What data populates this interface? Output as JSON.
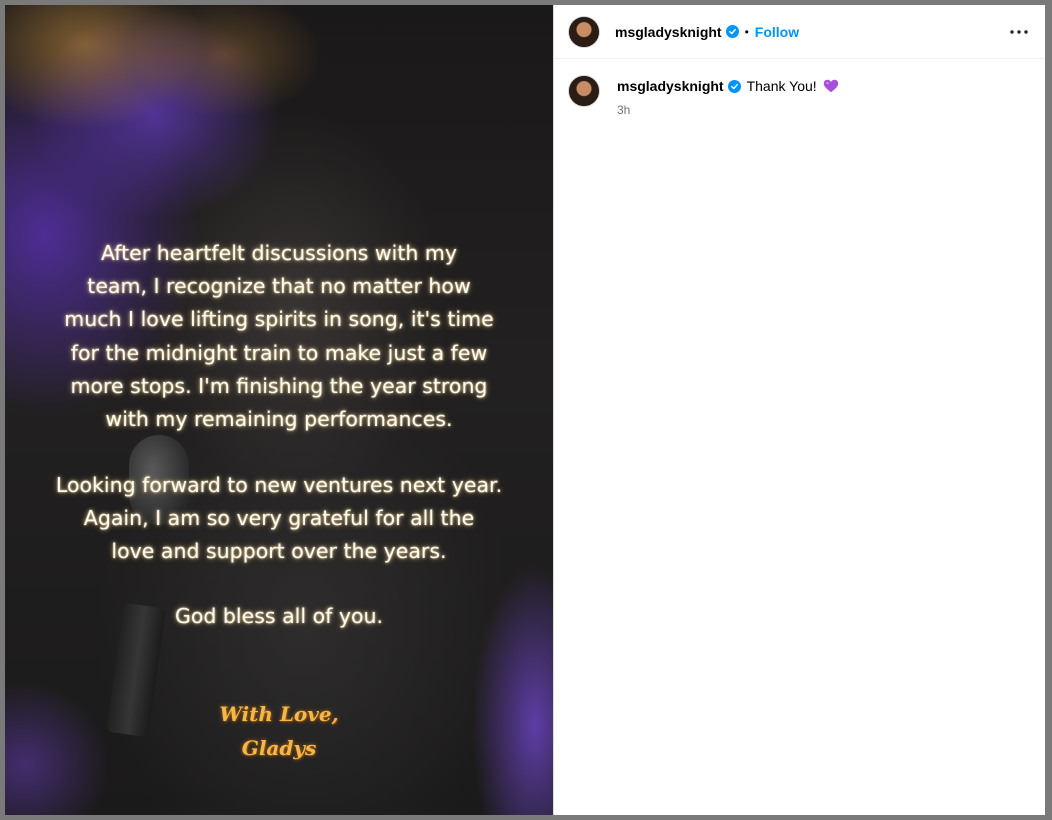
{
  "post": {
    "image_text": {
      "paragraph_1": [
        "After heartfelt discussions with my",
        "team, I recognize that no matter how",
        "much I love lifting spirits in song, it's time",
        "for the midnight train to make just a few",
        "more stops. I'm finishing the year strong",
        "with my remaining performances."
      ],
      "paragraph_2": [
        "Looking forward to new ventures next year.",
        "Again, I am so very grateful for all the",
        "love and support over the years."
      ],
      "paragraph_3": "God bless all of you.",
      "signoff_1": "With Love,",
      "signoff_2": "Gladys"
    }
  },
  "header": {
    "username": "msgladysknight",
    "separator": "•",
    "follow_label": "Follow",
    "more_icon": "more-horizontal-icon",
    "verified_icon": "verified-badge-icon"
  },
  "caption": {
    "username": "msgladysknight",
    "text": "Thank You!",
    "emoji_icon": "purple-heart-icon",
    "time": "3h"
  },
  "colors": {
    "accent": "#0095f6",
    "heart": "#a64fd8",
    "signoff": "#f6b64a"
  }
}
